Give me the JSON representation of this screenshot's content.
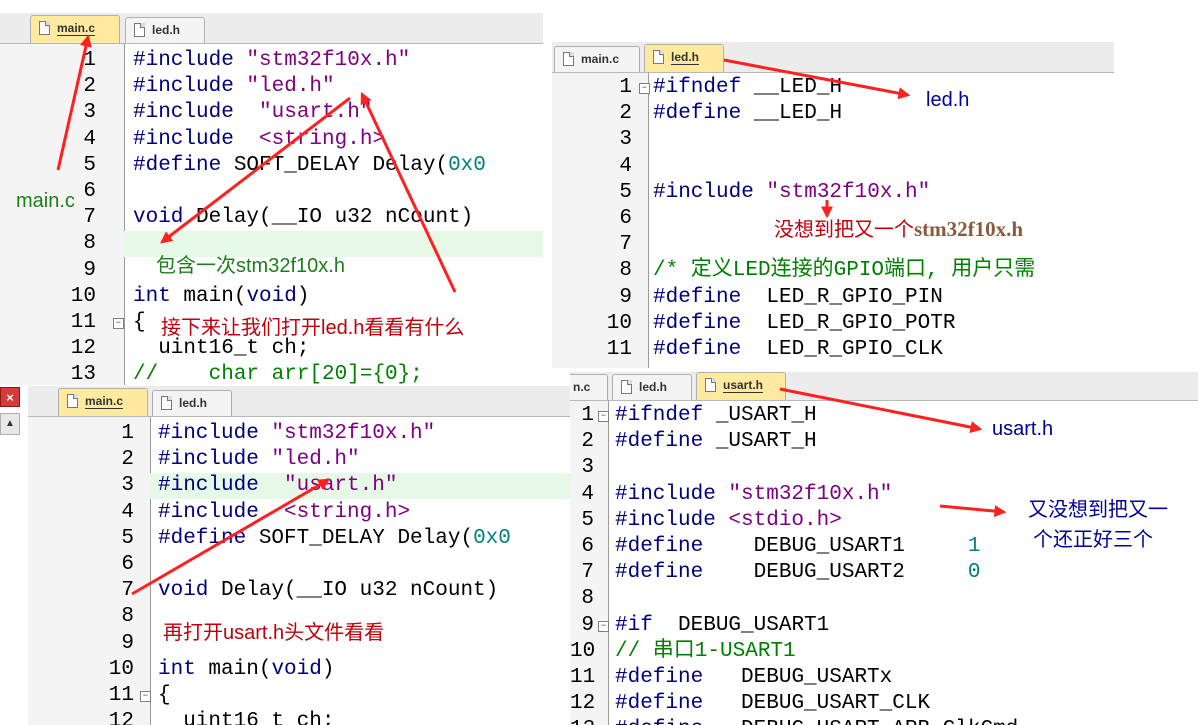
{
  "panels": {
    "main_top": {
      "tabs": [
        {
          "label": "main.c"
        },
        {
          "label": "led.h"
        }
      ],
      "lines": [
        {
          "num": "1",
          "tokens": [
            {
              "t": "#include ",
              "c": "k"
            },
            {
              "t": "\"stm32f10x.h\"",
              "c": "s"
            }
          ]
        },
        {
          "num": "2",
          "tokens": [
            {
              "t": "#include ",
              "c": "k"
            },
            {
              "t": "\"led.h\"",
              "c": "s"
            }
          ]
        },
        {
          "num": "3",
          "tokens": [
            {
              "t": "#include ",
              "c": "k"
            },
            {
              "t": " \"usart.h\"",
              "c": "s"
            }
          ]
        },
        {
          "num": "4",
          "tokens": [
            {
              "t": "#include ",
              "c": "k"
            },
            {
              "t": " <string.h>",
              "c": "s"
            }
          ]
        },
        {
          "num": "5",
          "tokens": [
            {
              "t": "#define ",
              "c": "k"
            },
            {
              "t": "SOFT_DELAY Delay(",
              "c": ""
            },
            {
              "t": "0x0",
              "c": "n"
            }
          ]
        },
        {
          "num": "6",
          "tokens": []
        },
        {
          "num": "7",
          "tokens": [
            {
              "t": "void ",
              "c": "k"
            },
            {
              "t": "Delay(__IO u32 nCount)",
              "c": ""
            }
          ]
        },
        {
          "num": "8",
          "tokens": []
        },
        {
          "num": "9",
          "tokens": []
        },
        {
          "num": "10",
          "tokens": [
            {
              "t": "int ",
              "c": "k"
            },
            {
              "t": "main(",
              "c": ""
            },
            {
              "t": "void",
              "c": "k"
            },
            {
              "t": ")",
              "c": ""
            }
          ]
        },
        {
          "num": "11",
          "tokens": [
            {
              "t": "{",
              "c": ""
            }
          ]
        },
        {
          "num": "12",
          "tokens": [
            {
              "t": "  uint16_t ch;",
              "c": ""
            }
          ]
        },
        {
          "num": "13",
          "tokens": [
            {
              "t": "//    char arr[20]={0};",
              "c": "c"
            }
          ]
        }
      ]
    },
    "led": {
      "tabs": [
        {
          "label": "main.c"
        },
        {
          "label": "led.h"
        }
      ],
      "lines": [
        {
          "num": "1",
          "tokens": [
            {
              "t": "#ifndef ",
              "c": "k"
            },
            {
              "t": "__LED_H",
              "c": ""
            }
          ]
        },
        {
          "num": "2",
          "tokens": [
            {
              "t": "#define ",
              "c": "k"
            },
            {
              "t": "__LED_H",
              "c": ""
            }
          ]
        },
        {
          "num": "3",
          "tokens": []
        },
        {
          "num": "4",
          "tokens": []
        },
        {
          "num": "5",
          "tokens": [
            {
              "t": "#include ",
              "c": "k"
            },
            {
              "t": "\"stm32f10x.h\"",
              "c": "s"
            }
          ]
        },
        {
          "num": "6",
          "tokens": []
        },
        {
          "num": "7",
          "tokens": []
        },
        {
          "num": "8",
          "tokens": [
            {
              "t": "/* 定义LED连接的GPIO端口, 用户只需",
              "c": "c"
            }
          ]
        },
        {
          "num": "9",
          "tokens": [
            {
              "t": "#define ",
              "c": "k"
            },
            {
              "t": " LED_R_GPIO_PIN",
              "c": ""
            }
          ]
        },
        {
          "num": "10",
          "tokens": [
            {
              "t": "#define ",
              "c": "k"
            },
            {
              "t": " LED_R_GPIO_POTR",
              "c": ""
            }
          ]
        },
        {
          "num": "11",
          "tokens": [
            {
              "t": "#define ",
              "c": "k"
            },
            {
              "t": " LED_R_GPIO_CLK",
              "c": ""
            }
          ]
        }
      ]
    },
    "main_bottom": {
      "tabs": [
        {
          "label": "main.c"
        },
        {
          "label": "led.h"
        }
      ],
      "lines": [
        {
          "num": "1",
          "tokens": [
            {
              "t": "#include ",
              "c": "k"
            },
            {
              "t": "\"stm32f10x.h\"",
              "c": "s"
            }
          ]
        },
        {
          "num": "2",
          "tokens": [
            {
              "t": "#include ",
              "c": "k"
            },
            {
              "t": "\"led.h\"",
              "c": "s"
            }
          ]
        },
        {
          "num": "3",
          "tokens": [
            {
              "t": "#include ",
              "c": "k"
            },
            {
              "t": " \"usart.h\"",
              "c": "s"
            }
          ]
        },
        {
          "num": "4",
          "tokens": [
            {
              "t": "#include ",
              "c": "k"
            },
            {
              "t": " <string.h>",
              "c": "s"
            }
          ]
        },
        {
          "num": "5",
          "tokens": [
            {
              "t": "#define ",
              "c": "k"
            },
            {
              "t": "SOFT_DELAY Delay(",
              "c": ""
            },
            {
              "t": "0x0",
              "c": "n"
            }
          ]
        },
        {
          "num": "6",
          "tokens": []
        },
        {
          "num": "7",
          "tokens": [
            {
              "t": "void ",
              "c": "k"
            },
            {
              "t": "Delay(__IO u32 nCount)",
              "c": ""
            }
          ]
        },
        {
          "num": "8",
          "tokens": []
        },
        {
          "num": "9",
          "tokens": []
        },
        {
          "num": "10",
          "tokens": [
            {
              "t": "int ",
              "c": "k"
            },
            {
              "t": "main(",
              "c": ""
            },
            {
              "t": "void",
              "c": "k"
            },
            {
              "t": ")",
              "c": ""
            }
          ]
        },
        {
          "num": "11",
          "tokens": [
            {
              "t": "{",
              "c": ""
            }
          ]
        },
        {
          "num": "12",
          "tokens": [
            {
              "t": "  uint16_t ch;",
              "c": ""
            }
          ]
        }
      ]
    },
    "usart": {
      "tabs": [
        {
          "label": "n.c"
        },
        {
          "label": "led.h"
        },
        {
          "label": "usart.h"
        }
      ],
      "lines": [
        {
          "num": "1",
          "tokens": [
            {
              "t": "#ifndef ",
              "c": "k"
            },
            {
              "t": "_USART_H",
              "c": ""
            }
          ]
        },
        {
          "num": "2",
          "tokens": [
            {
              "t": "#define ",
              "c": "k"
            },
            {
              "t": "_USART_H",
              "c": ""
            }
          ]
        },
        {
          "num": "3",
          "tokens": []
        },
        {
          "num": "4",
          "tokens": [
            {
              "t": "#include ",
              "c": "k"
            },
            {
              "t": "\"stm32f10x.h\"",
              "c": "s"
            }
          ]
        },
        {
          "num": "5",
          "tokens": [
            {
              "t": "#include ",
              "c": "k"
            },
            {
              "t": "<stdio.h>",
              "c": "s"
            }
          ]
        },
        {
          "num": "6",
          "tokens": [
            {
              "t": "#define ",
              "c": "k"
            },
            {
              "t": "   DEBUG_USART1     ",
              "c": ""
            },
            {
              "t": "1",
              "c": "n"
            }
          ]
        },
        {
          "num": "7",
          "tokens": [
            {
              "t": "#define ",
              "c": "k"
            },
            {
              "t": "   DEBUG_USART2     ",
              "c": ""
            },
            {
              "t": "0",
              "c": "n"
            }
          ]
        },
        {
          "num": "8",
          "tokens": []
        },
        {
          "num": "9",
          "tokens": [
            {
              "t": "#if ",
              "c": "k"
            },
            {
              "t": " DEBUG_USART1",
              "c": ""
            }
          ]
        },
        {
          "num": "10",
          "tokens": [
            {
              "t": "// 串口1-USART1",
              "c": "c"
            }
          ]
        },
        {
          "num": "11",
          "tokens": [
            {
              "t": "#define ",
              "c": "k"
            },
            {
              "t": "  DEBUG_USARTx",
              "c": ""
            }
          ]
        },
        {
          "num": "12",
          "tokens": [
            {
              "t": "#define ",
              "c": "k"
            },
            {
              "t": "  DEBUG_USART_CLK",
              "c": ""
            }
          ]
        },
        {
          "num": "13",
          "tokens": [
            {
              "t": "#define ",
              "c": "k"
            },
            {
              "t": "  DEBUG_USART_APB_ClkCmd",
              "c": ""
            }
          ]
        }
      ]
    }
  },
  "annotations": {
    "main_c": "main.c",
    "contains_once": "包含一次stm32f10x.h",
    "open_led": "接下来让我们打开led.h看看有什么",
    "led_h": "led.h",
    "unexpected_1_prefix": "没想到把又一个",
    "unexpected_1_file": "stm32f10x.h",
    "open_usart": "再打开usart.h头文件看看",
    "usart_h": "usart.h",
    "unexpected_2_line1": "又没想到把又一",
    "unexpected_2_line2": "个还正好三个"
  },
  "icons": {
    "close": "×",
    "scroll_up": "▲",
    "fold": "−"
  },
  "colors": {
    "keyword": "#00007f",
    "string": "#800080",
    "number": "#008080",
    "comment": "#008000",
    "arrow": "#ff2020",
    "active_tab": "#ffeaa0"
  }
}
